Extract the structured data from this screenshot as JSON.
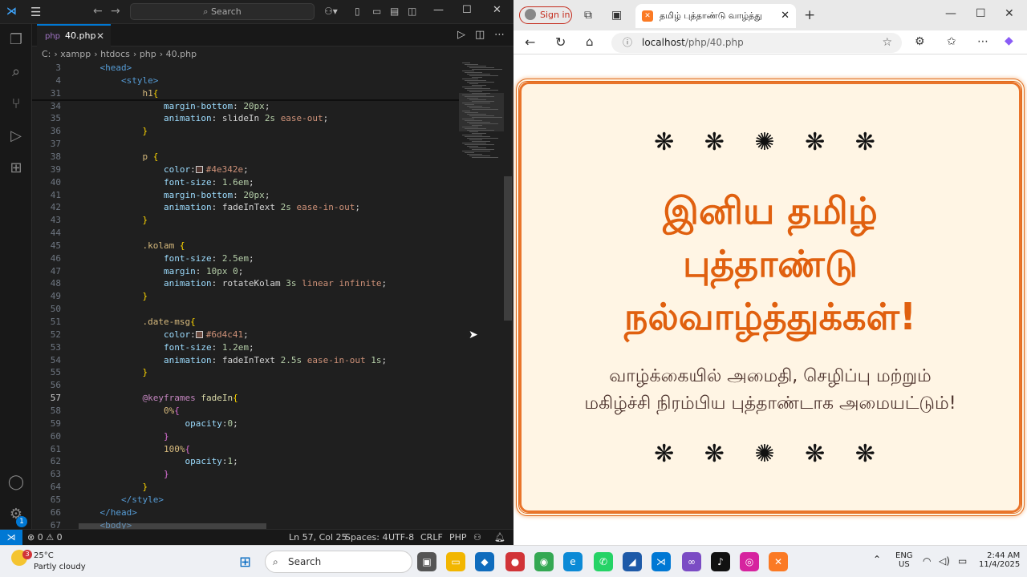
{
  "vscode": {
    "search_placeholder": "Search",
    "tab": {
      "label": "40.php"
    },
    "breadcrumb": [
      "C:",
      "xampp",
      "htdocs",
      "php",
      "40.php"
    ],
    "status": {
      "problems": "0",
      "warnings": "0",
      "position": "Ln 57, Col 25",
      "spaces": "Spaces: 4",
      "encoding": "UTF-8",
      "eol": "CRLF",
      "language": "PHP"
    },
    "settings_badge": "1"
  },
  "browser": {
    "signin": "Sign in",
    "tab_title": "தமிழ் புத்தாண்டு வாழ்த்து",
    "url_host": "localhost",
    "url_path": "/php/40.php",
    "page": {
      "kolam_top": "❋ ❋ ✺ ❋ ❋",
      "heading_line1": "இனிய தமிழ்",
      "heading_line2": "புத்தாண்டு",
      "heading_line3": "நல்வாழ்த்துக்கள்!",
      "msg_line1": "வாழ்க்கையில் அமைதி, செழிப்பு மற்றும்",
      "msg_line2": "மகிழ்ச்சி நிரம்பிய புத்தாண்டாக அமையட்டும்!",
      "kolam_bottom": "❋ ❋ ✺ ❋ ❋"
    }
  },
  "taskbar": {
    "weather_temp": "25°C",
    "weather_desc": "Partly cloudy",
    "weather_badge": "3",
    "search": "Search",
    "lang1": "ENG",
    "lang2": "US",
    "time": "2:44 AM",
    "date": "11/4/2025"
  },
  "colors": {
    "accent": "#0078d4",
    "heading": "#e0600f",
    "p_color": "#4e342e",
    "date_color": "#6d4c41"
  }
}
